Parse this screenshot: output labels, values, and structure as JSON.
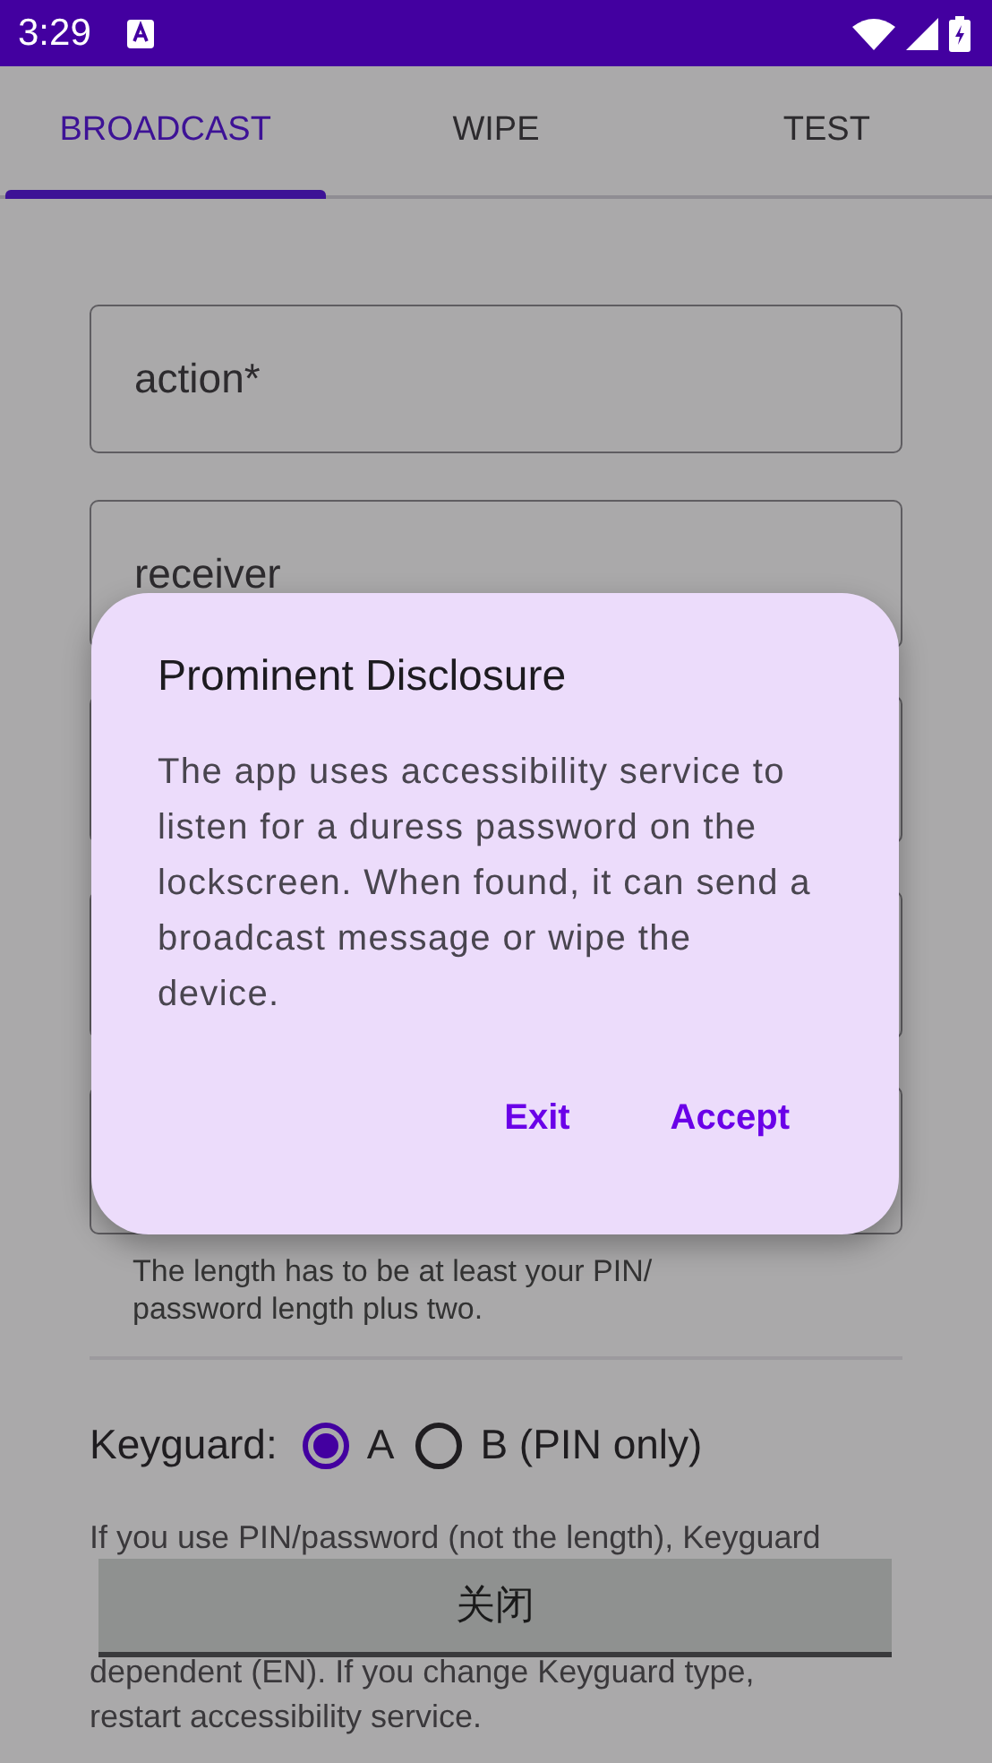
{
  "status_bar": {
    "time": "3:29"
  },
  "tabs": [
    {
      "label": "BROADCAST",
      "selected": true
    },
    {
      "label": "WIPE",
      "selected": false
    },
    {
      "label": "TEST",
      "selected": false
    }
  ],
  "fields": [
    {
      "placeholder": "action*"
    },
    {
      "placeholder": "receiver"
    }
  ],
  "helper_text": "The length has to be at least your PIN/ password length plus two.",
  "keyguard": {
    "label": "Keyguard:",
    "options": [
      {
        "label": "A",
        "selected": true
      },
      {
        "label": "B (PIN only)",
        "selected": false
      }
    ]
  },
  "note_lines": [
    "If you use PIN/password (not the length), Keyguard",
    "dependent (EN). If you change Keyguard type,",
    "restart accessibility service."
  ],
  "dialog": {
    "title": "Prominent Disclosure",
    "message": "The app uses accessibility service to listen for a duress password on the lockscreen. When found, it can send a broadcast message or wipe the device.",
    "buttons": [
      "Exit",
      "Accept"
    ]
  },
  "toast": {
    "text": "关闭"
  }
}
